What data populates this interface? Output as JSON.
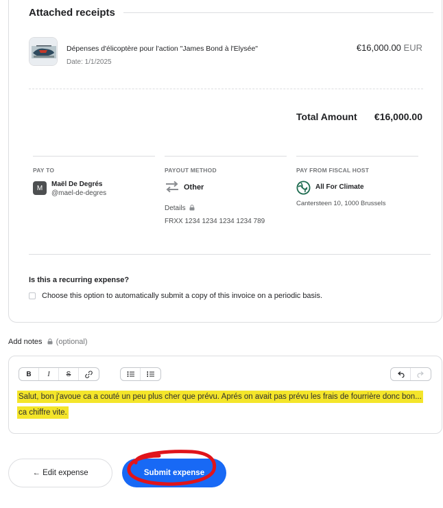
{
  "receipts": {
    "section_title": "Attached receipts",
    "items": [
      {
        "title": "Dépenses d'élicoptère pour l'action \"James Bond à l'Elysée\"",
        "date": "Date: 1/1/2025",
        "amount": "€16,000.00",
        "currency": "EUR"
      }
    ]
  },
  "total": {
    "label": "Total Amount",
    "value": "€16,000.00"
  },
  "pay_to": {
    "header": "PAY TO",
    "avatar_letter": "M",
    "name": "Maël De Degrés",
    "handle": "@mael-de-degres"
  },
  "payout_method": {
    "header": "PAYOUT METHOD",
    "method": "Other",
    "details_label": "Details",
    "details_value": "FRXX 1234 1234 1234 1234 789"
  },
  "fiscal_host": {
    "header": "PAY FROM FISCAL HOST",
    "name": "All For Climate",
    "address": "Cantersteen 10, 1000 Brussels"
  },
  "recurring": {
    "question": "Is this a recurring expense?",
    "option_label": "Choose this option to automatically submit a copy of this invoice on a periodic basis."
  },
  "notes": {
    "label": "Add notes",
    "optional": "(optional)",
    "toolbar": {
      "bold": "B",
      "italic": "I",
      "strike": "S"
    },
    "text": "Salut, bon j'avoue ca a couté un peu plus cher que prévu. Aprés on avait pas prévu les frais de fourrière donc bon... ca chiffre vite."
  },
  "actions": {
    "edit_label": "← Edit expense",
    "submit_label": "Submit expense"
  },
  "colors": {
    "accent": "#1869f5",
    "highlight": "#f4e52a",
    "annotation": "#e0141b",
    "border": "#dcdde0"
  }
}
